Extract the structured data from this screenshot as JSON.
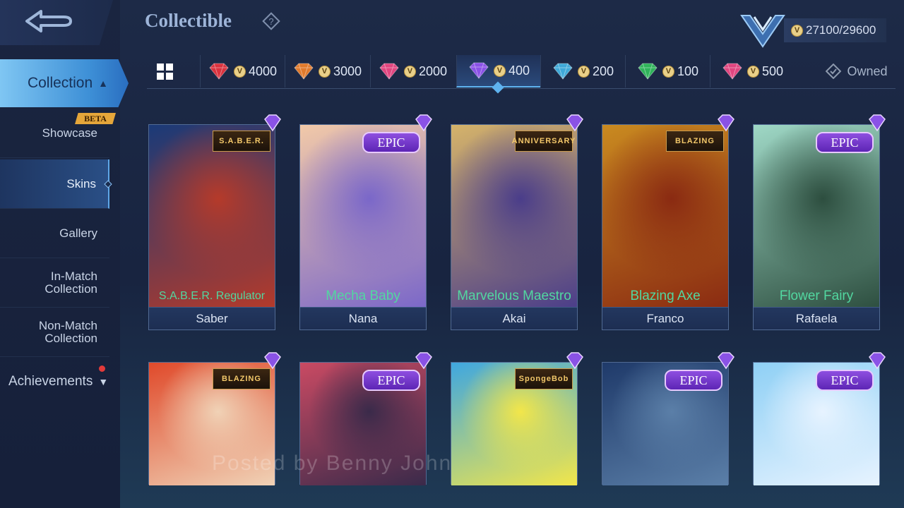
{
  "header": {
    "title": "Collectible",
    "points": "27100/29600"
  },
  "sidebar": {
    "collection_label": "Collection",
    "beta_label": "BETA",
    "items": [
      {
        "label": "Showcase"
      },
      {
        "label": "Skins"
      },
      {
        "label": "Gallery"
      },
      {
        "label": "In-Match Collection"
      },
      {
        "label": "Non-Match Collection"
      }
    ],
    "achievements_label": "Achievements"
  },
  "filters": {
    "tiers": [
      {
        "price": "4000",
        "color": "#d9323e"
      },
      {
        "price": "3000",
        "color": "#e07a2c"
      },
      {
        "price": "2000",
        "color": "#e0457f"
      },
      {
        "price": "400",
        "color": "#8a52e6"
      },
      {
        "price": "200",
        "color": "#3fa9d8"
      },
      {
        "price": "100",
        "color": "#2fb35a"
      },
      {
        "price": "500",
        "color": "#e0457f"
      }
    ],
    "active_tier": "400",
    "owned_label": "Owned"
  },
  "cards": [
    {
      "skin": "S.A.B.E.R. Regulator",
      "hero": "Saber",
      "badge": "S.A.B.E.R.",
      "colors": [
        "#1a3a78",
        "#b53a2a"
      ]
    },
    {
      "skin": "Mecha Baby",
      "hero": "Nana",
      "badge": "EPIC",
      "colors": [
        "#f2c9a8",
        "#7a67c9"
      ]
    },
    {
      "skin": "Marvelous Maestro",
      "hero": "Akai",
      "badge": "ANNIVERSARY",
      "colors": [
        "#d5b36a",
        "#4a3d8a"
      ]
    },
    {
      "skin": "Blazing Axe",
      "hero": "Franco",
      "badge": "BLAZING",
      "colors": [
        "#c98a20",
        "#8a2a12"
      ]
    },
    {
      "skin": "Flower Fairy",
      "hero": "Rafaela",
      "badge": "EPIC",
      "colors": [
        "#9fd8c6",
        "#2d4e3f"
      ]
    },
    {
      "skin": "",
      "hero": "",
      "badge": "BLAZING",
      "colors": [
        "#e04a2b",
        "#f0d2b6"
      ]
    },
    {
      "skin": "",
      "hero": "",
      "badge": "EPIC",
      "colors": [
        "#c94a63",
        "#3a2a4a"
      ]
    },
    {
      "skin": "",
      "hero": "",
      "badge": "SpongeBob",
      "colors": [
        "#3fa7e0",
        "#f2e64a"
      ]
    },
    {
      "skin": "",
      "hero": "",
      "badge": "EPIC",
      "colors": [
        "#1f3a6a",
        "#5b7fa8"
      ]
    },
    {
      "skin": "",
      "hero": "",
      "badge": "EPIC",
      "colors": [
        "#8fd0f5",
        "#e7f3ff"
      ]
    }
  ],
  "watermark": "Posted by Benny John"
}
